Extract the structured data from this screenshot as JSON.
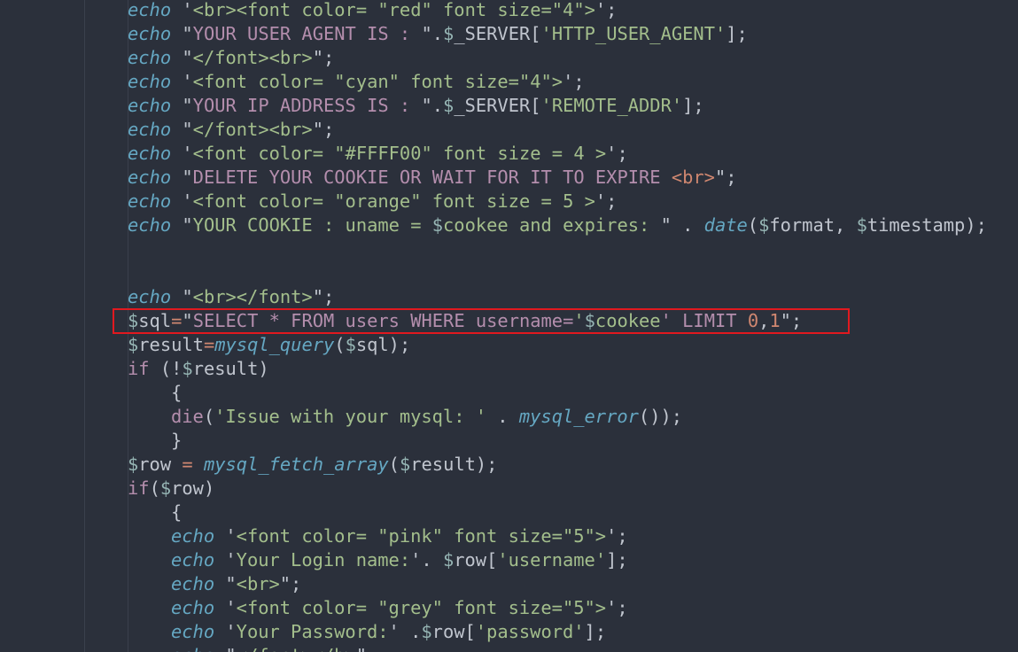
{
  "lines": [
    {
      "indent": 0,
      "tokens": [
        {
          "t": "echo",
          "c": "kw"
        },
        {
          "t": " '",
          "c": "punc"
        },
        {
          "t": "<br><font color= \"red\" font size=\"4\">",
          "c": "str"
        },
        {
          "t": "';",
          "c": "punc"
        }
      ]
    },
    {
      "indent": 0,
      "tokens": [
        {
          "t": "echo",
          "c": "kw"
        },
        {
          "t": " \"",
          "c": "punc"
        },
        {
          "t": "YOUR USER AGENT IS : ",
          "c": "sql"
        },
        {
          "t": "\".",
          "c": "punc"
        },
        {
          "t": "$",
          "c": "dollar"
        },
        {
          "t": "_SERVER[",
          "c": "var"
        },
        {
          "t": "'HTTP_USER_AGENT'",
          "c": "str"
        },
        {
          "t": "];",
          "c": "punc"
        }
      ]
    },
    {
      "indent": 0,
      "tokens": [
        {
          "t": "echo",
          "c": "kw"
        },
        {
          "t": " \"",
          "c": "punc"
        },
        {
          "t": "</font><br>",
          "c": "str"
        },
        {
          "t": "\";",
          "c": "punc"
        }
      ]
    },
    {
      "indent": 0,
      "tokens": [
        {
          "t": "echo",
          "c": "kw"
        },
        {
          "t": " '",
          "c": "punc"
        },
        {
          "t": "<font color= \"cyan\" font size=\"4\">",
          "c": "str"
        },
        {
          "t": "';",
          "c": "punc"
        }
      ]
    },
    {
      "indent": 0,
      "tokens": [
        {
          "t": "echo",
          "c": "kw"
        },
        {
          "t": " \"",
          "c": "punc"
        },
        {
          "t": "YOUR IP ADDRESS IS : ",
          "c": "sql"
        },
        {
          "t": "\".",
          "c": "punc"
        },
        {
          "t": "$",
          "c": "dollar"
        },
        {
          "t": "_SERVER[",
          "c": "var"
        },
        {
          "t": "'REMOTE_ADDR'",
          "c": "str"
        },
        {
          "t": "];",
          "c": "punc"
        }
      ]
    },
    {
      "indent": 0,
      "tokens": [
        {
          "t": "echo",
          "c": "kw"
        },
        {
          "t": " \"",
          "c": "punc"
        },
        {
          "t": "</font><br>",
          "c": "str"
        },
        {
          "t": "\";",
          "c": "punc"
        }
      ]
    },
    {
      "indent": 0,
      "tokens": [
        {
          "t": "echo",
          "c": "kw"
        },
        {
          "t": " '",
          "c": "punc"
        },
        {
          "t": "<font color= \"#FFFF00\" font size = 4 >",
          "c": "str"
        },
        {
          "t": "';",
          "c": "punc"
        }
      ]
    },
    {
      "indent": 0,
      "tokens": [
        {
          "t": "echo",
          "c": "kw"
        },
        {
          "t": " \"",
          "c": "punc"
        },
        {
          "t": "DELETE YOUR COOKIE OR WAIT FOR IT TO EXPIRE ",
          "c": "sql"
        },
        {
          "t": "<br>",
          "c": "amber"
        },
        {
          "t": "\";",
          "c": "punc"
        }
      ]
    },
    {
      "indent": 0,
      "tokens": [
        {
          "t": "echo",
          "c": "kw"
        },
        {
          "t": " '",
          "c": "punc"
        },
        {
          "t": "<font color= \"orange\" font size = 5 >",
          "c": "str"
        },
        {
          "t": "';",
          "c": "punc"
        }
      ]
    },
    {
      "indent": 0,
      "tokens": [
        {
          "t": "echo",
          "c": "kw"
        },
        {
          "t": " \"",
          "c": "punc"
        },
        {
          "t": "YOUR COOKIE : uname = ",
          "c": "str"
        },
        {
          "t": "$",
          "c": "dollar"
        },
        {
          "t": "cookee and expires: ",
          "c": "str"
        },
        {
          "t": "\" . ",
          "c": "punc"
        },
        {
          "t": "date",
          "c": "func"
        },
        {
          "t": "(",
          "c": "punc"
        },
        {
          "t": "$",
          "c": "dollar"
        },
        {
          "t": "format, ",
          "c": "var"
        },
        {
          "t": "$",
          "c": "dollar"
        },
        {
          "t": "timestamp);",
          "c": "var"
        }
      ]
    },
    {
      "indent": 0,
      "tokens": []
    },
    {
      "indent": 0,
      "tokens": []
    },
    {
      "indent": 0,
      "tokens": [
        {
          "t": "echo",
          "c": "kw"
        },
        {
          "t": " \"",
          "c": "punc"
        },
        {
          "t": "<br></font>",
          "c": "str"
        },
        {
          "t": "\";",
          "c": "punc"
        }
      ]
    },
    {
      "indent": 0,
      "tokens": [
        {
          "t": "$",
          "c": "dollar"
        },
        {
          "t": "sql",
          "c": "var"
        },
        {
          "t": "=",
          "c": "amber"
        },
        {
          "t": "\"",
          "c": "punc"
        },
        {
          "t": "SELECT * FROM users WHERE username=",
          "c": "sql"
        },
        {
          "t": "'",
          "c": "str"
        },
        {
          "t": "$",
          "c": "dollar"
        },
        {
          "t": "cookee",
          "c": "str"
        },
        {
          "t": "' LIMIT ",
          "c": "sql"
        },
        {
          "t": "0",
          "c": "num"
        },
        {
          "t": ",",
          "c": "punc"
        },
        {
          "t": "1",
          "c": "num"
        },
        {
          "t": "\";",
          "c": "punc"
        }
      ]
    },
    {
      "indent": 0,
      "tokens": [
        {
          "t": "$",
          "c": "dollar"
        },
        {
          "t": "result",
          "c": "var"
        },
        {
          "t": "=",
          "c": "amber"
        },
        {
          "t": "mysql_query",
          "c": "func"
        },
        {
          "t": "(",
          "c": "punc"
        },
        {
          "t": "$",
          "c": "dollar"
        },
        {
          "t": "sql);",
          "c": "var"
        }
      ]
    },
    {
      "indent": 0,
      "tokens": [
        {
          "t": "if",
          "c": "ctrl"
        },
        {
          "t": " (!",
          "c": "punc"
        },
        {
          "t": "$",
          "c": "dollar"
        },
        {
          "t": "result)",
          "c": "var"
        }
      ]
    },
    {
      "indent": 1,
      "tokens": [
        {
          "t": "{",
          "c": "punc"
        }
      ]
    },
    {
      "indent": 1,
      "tokens": [
        {
          "t": "die",
          "c": "ctrl"
        },
        {
          "t": "(",
          "c": "punc"
        },
        {
          "t": "'Issue with your mysql: '",
          "c": "str"
        },
        {
          "t": " . ",
          "c": "punc"
        },
        {
          "t": "mysql_error",
          "c": "func"
        },
        {
          "t": "());",
          "c": "punc"
        }
      ]
    },
    {
      "indent": 1,
      "tokens": [
        {
          "t": "}",
          "c": "punc"
        }
      ]
    },
    {
      "indent": 0,
      "tokens": [
        {
          "t": "$",
          "c": "dollar"
        },
        {
          "t": "row",
          "c": "var"
        },
        {
          "t": " = ",
          "c": "amber"
        },
        {
          "t": "mysql_fetch_array",
          "c": "func"
        },
        {
          "t": "(",
          "c": "punc"
        },
        {
          "t": "$",
          "c": "dollar"
        },
        {
          "t": "result);",
          "c": "var"
        }
      ]
    },
    {
      "indent": 0,
      "tokens": [
        {
          "t": "if",
          "c": "ctrl"
        },
        {
          "t": "(",
          "c": "punc"
        },
        {
          "t": "$",
          "c": "dollar"
        },
        {
          "t": "row)",
          "c": "var"
        }
      ]
    },
    {
      "indent": 1,
      "tokens": [
        {
          "t": "{",
          "c": "punc"
        }
      ]
    },
    {
      "indent": 1,
      "tokens": [
        {
          "t": "echo",
          "c": "kw"
        },
        {
          "t": " '",
          "c": "punc"
        },
        {
          "t": "<font color= \"pink\" font size=\"5\">",
          "c": "str"
        },
        {
          "t": "';",
          "c": "punc"
        }
      ]
    },
    {
      "indent": 1,
      "tokens": [
        {
          "t": "echo",
          "c": "kw"
        },
        {
          "t": " '",
          "c": "punc"
        },
        {
          "t": "Your Login name:",
          "c": "str"
        },
        {
          "t": "'. ",
          "c": "punc"
        },
        {
          "t": "$",
          "c": "dollar"
        },
        {
          "t": "row[",
          "c": "var"
        },
        {
          "t": "'username'",
          "c": "str"
        },
        {
          "t": "];",
          "c": "punc"
        }
      ]
    },
    {
      "indent": 1,
      "tokens": [
        {
          "t": "echo",
          "c": "kw"
        },
        {
          "t": " \"",
          "c": "punc"
        },
        {
          "t": "<br>",
          "c": "str"
        },
        {
          "t": "\";",
          "c": "punc"
        }
      ]
    },
    {
      "indent": 1,
      "tokens": [
        {
          "t": "echo",
          "c": "kw"
        },
        {
          "t": " '",
          "c": "punc"
        },
        {
          "t": "<font color= \"grey\" font size=\"5\">",
          "c": "str"
        },
        {
          "t": "';",
          "c": "punc"
        }
      ]
    },
    {
      "indent": 1,
      "tokens": [
        {
          "t": "echo",
          "c": "kw"
        },
        {
          "t": " '",
          "c": "punc"
        },
        {
          "t": "Your Password:",
          "c": "str"
        },
        {
          "t": "' .",
          "c": "punc"
        },
        {
          "t": "$",
          "c": "dollar"
        },
        {
          "t": "row[",
          "c": "var"
        },
        {
          "t": "'password'",
          "c": "str"
        },
        {
          "t": "];",
          "c": "punc"
        }
      ]
    },
    {
      "indent": 1,
      "tokens": [
        {
          "t": "echo",
          "c": "kw"
        },
        {
          "t": " \"",
          "c": "punc"
        },
        {
          "t": "</font></b>",
          "c": "str"
        },
        {
          "t": "\";",
          "c": "punc"
        }
      ]
    }
  ],
  "highlight": {
    "line_index": 13,
    "color": "#e1191f"
  },
  "theme": {
    "background": "#2b303b",
    "keyword": "#65a7c2",
    "string": "#a3be8c",
    "sql": "#b48ead",
    "number": "#d08770",
    "text": "#c0c5ce"
  }
}
